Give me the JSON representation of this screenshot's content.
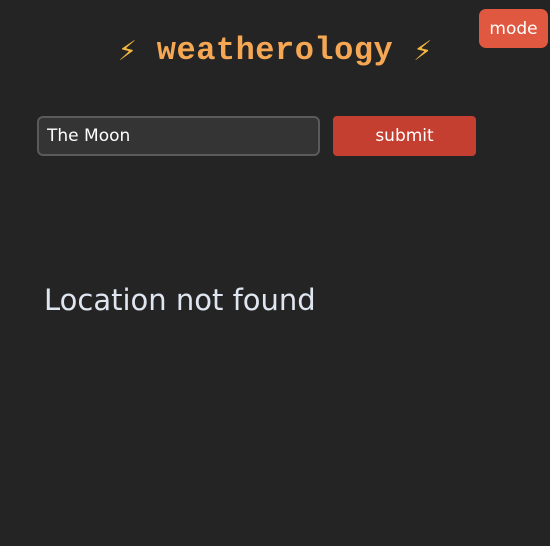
{
  "header": {
    "left_icon": "⚡",
    "title": "weatherology",
    "right_icon": "⚡",
    "icon_name": "lightning-bolt-icon",
    "title_color": "#f5a754"
  },
  "mode_button": {
    "label": "mode",
    "color": "#e0583f"
  },
  "search": {
    "value": "The Moon"
  },
  "submit_button": {
    "label": "submit",
    "color": "#c53f31"
  },
  "result": {
    "message": "Location not found"
  },
  "theme": {
    "background": "#242424"
  }
}
